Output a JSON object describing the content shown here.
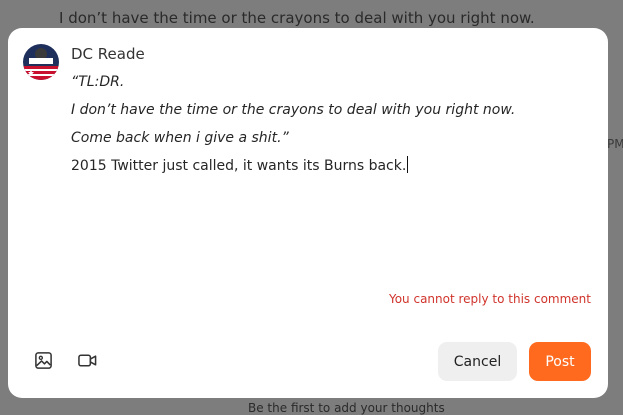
{
  "background": {
    "top_text": "I don’t have the time or the crayons to deal with you right now.",
    "right_fragment": "PM",
    "bottom_text": "Be the first to add your thoughts"
  },
  "comment": {
    "author": "DC Reade",
    "avatar_badge_text": "THE BRAGE 1956",
    "quote_lines": [
      "“TL:DR.",
      "I don’t have the time or the crayons to deal with you right now.",
      "Come back when i give a shit.”"
    ],
    "reply_text": "2015 Twitter just called, it wants its Burns back.",
    "error_message": "You cannot reply to this comment"
  },
  "toolbar": {
    "image_icon": "image-icon",
    "video_icon": "video-camera-icon"
  },
  "actions": {
    "cancel_label": "Cancel",
    "post_label": "Post"
  },
  "colors": {
    "accent": "#ff6a1f",
    "error": "#d0342c",
    "cancel_bg": "#efefef",
    "overlay": "#7d7d7d"
  }
}
